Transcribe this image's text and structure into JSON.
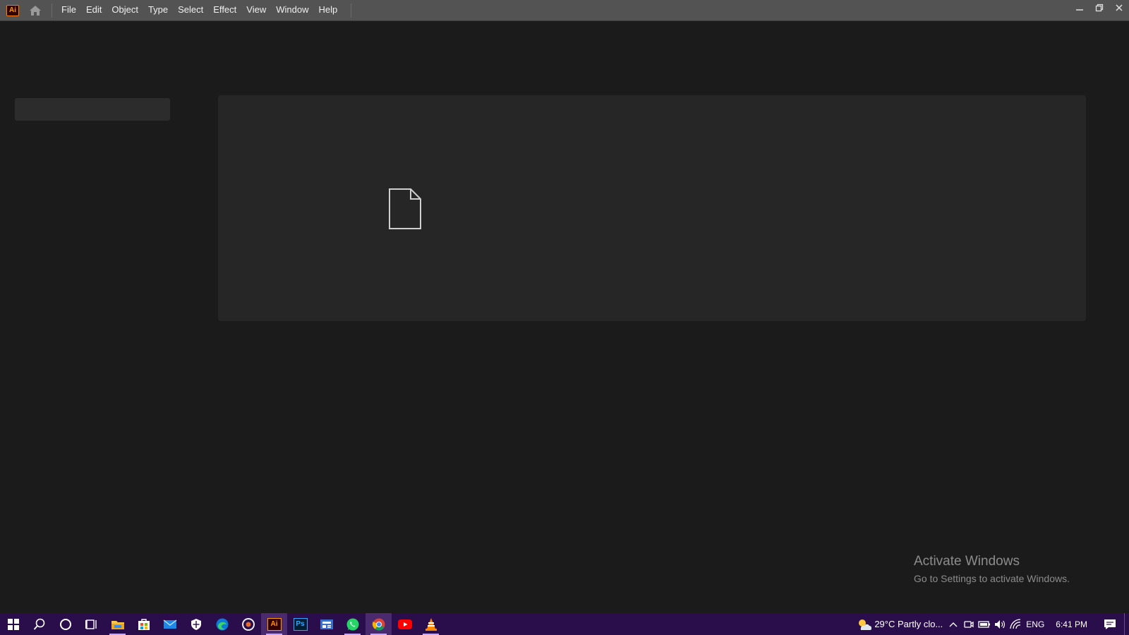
{
  "app": {
    "logo_text": "Ai"
  },
  "menu": {
    "items": [
      "File",
      "Edit",
      "Object",
      "Type",
      "Select",
      "Effect",
      "View",
      "Window",
      "Help"
    ]
  },
  "watermark": {
    "title": "Activate Windows",
    "subtitle": "Go to Settings to activate Windows."
  },
  "taskbar": {
    "apps": [
      "start-icon",
      "search-icon",
      "cortana-icon",
      "task-view-icon",
      "file-explorer-icon",
      "store-icon",
      "mail-icon",
      "security-icon",
      "edge-icon",
      "media-icon",
      "illustrator-icon",
      "photoshop-icon",
      "news-icon",
      "whatsapp-icon",
      "chrome-icon",
      "youtube-icon",
      "vlc-icon"
    ],
    "illustrator_label": "Ai",
    "photoshop_label": "Ps",
    "weather": "29°C  Partly clo...",
    "language": "ENG",
    "time": "6:41 PM"
  },
  "colors": {
    "accent": "#ff9a00",
    "taskbar": "#2a0d4b",
    "background": "#1b1b1b"
  }
}
